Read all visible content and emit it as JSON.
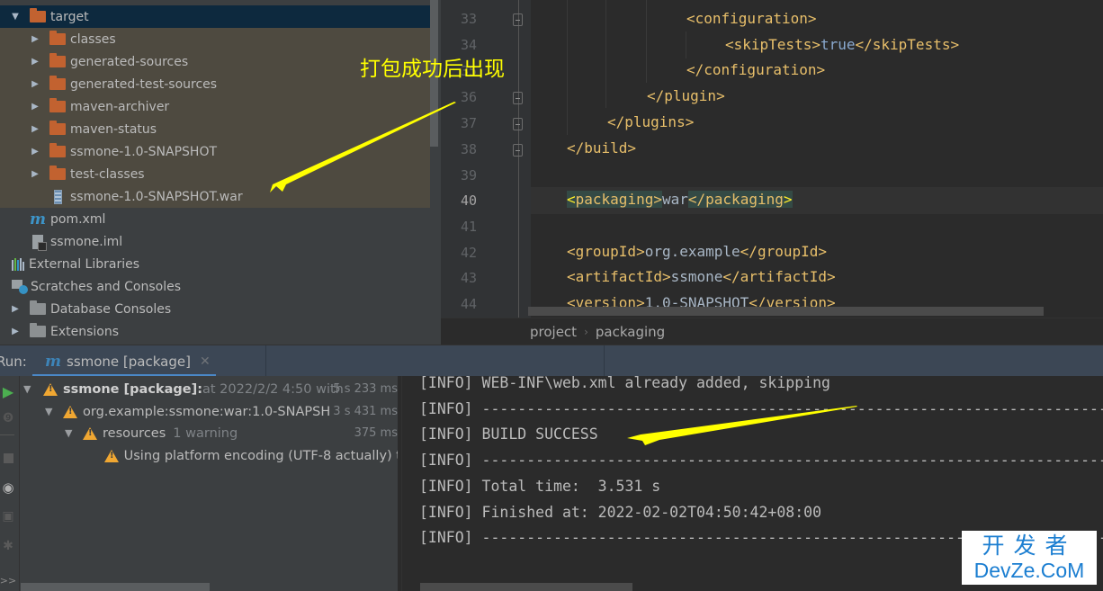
{
  "project_tree": {
    "items": [
      {
        "label": "target",
        "type": "folder",
        "expanded": true,
        "depth": 0
      },
      {
        "label": "classes",
        "type": "folder",
        "expanded": false,
        "depth": 1
      },
      {
        "label": "generated-sources",
        "type": "folder",
        "expanded": false,
        "depth": 1
      },
      {
        "label": "generated-test-sources",
        "type": "folder",
        "expanded": false,
        "depth": 1
      },
      {
        "label": "maven-archiver",
        "type": "folder",
        "expanded": false,
        "depth": 1
      },
      {
        "label": "maven-status",
        "type": "folder",
        "expanded": false,
        "depth": 1
      },
      {
        "label": "ssmone-1.0-SNAPSHOT",
        "type": "folder",
        "expanded": false,
        "depth": 1
      },
      {
        "label": "test-classes",
        "type": "folder",
        "expanded": false,
        "depth": 1
      },
      {
        "label": "ssmone-1.0-SNAPSHOT.war",
        "type": "war-file",
        "depth": 1
      },
      {
        "label": "pom.xml",
        "type": "maven-file",
        "depth": 0
      },
      {
        "label": "ssmone.iml",
        "type": "iml-file",
        "depth": 0
      },
      {
        "label": "External Libraries",
        "type": "libraries",
        "depth": -1
      },
      {
        "label": "Scratches and Consoles",
        "type": "scratches",
        "depth": -1
      },
      {
        "label": "Database Consoles",
        "type": "grey-folder",
        "depth": 0
      },
      {
        "label": "Extensions",
        "type": "grey-folder",
        "depth": 0
      }
    ]
  },
  "annotation": {
    "text": "打包成功后出现",
    "color": "#ffff00"
  },
  "editor": {
    "lines": [
      {
        "num": "33",
        "code": "<configuration>"
      },
      {
        "num": "34",
        "code": "<skipTests>true</skipTests>"
      },
      {
        "num": "35",
        "code": "</configuration>"
      },
      {
        "num": "36",
        "code": "</plugin>"
      },
      {
        "num": "37",
        "code": "</plugins>"
      },
      {
        "num": "38",
        "code": "</build>"
      },
      {
        "num": "39",
        "code": ""
      },
      {
        "num": "40",
        "code": "<packaging>war</packaging>"
      },
      {
        "num": "41",
        "code": ""
      },
      {
        "num": "42",
        "code": "<groupId>org.example</groupId>"
      },
      {
        "num": "43",
        "code": "<artifactId>ssmone</artifactId>"
      },
      {
        "num": "44",
        "code": "<version>1.0-SNAPSHOT</version>"
      }
    ],
    "tokens": {
      "l33": "<configuration>",
      "l34_open": "<skipTests>",
      "l34_val": "true",
      "l34_close": "</skipTests>",
      "l35": "</configuration>",
      "l36": "</plugin>",
      "l37": "</plugins>",
      "l38": "</build>",
      "l40_open_lt": "<",
      "l40_open": "packaging",
      "l40_open_gt": ">",
      "l40_val": "war",
      "l40_close_lt": "</",
      "l40_close": "packaging",
      "l40_close_gt": ">",
      "l42_open": "<groupId>",
      "l42_val": "org.example",
      "l42_close": "</groupId>",
      "l43_open": "<artifactId>",
      "l43_val": "ssmone",
      "l43_close": "</artifactId>",
      "l44_open": "<version>",
      "l44_val": "1.0-SNAPSHOT",
      "l44_close": "</version>"
    },
    "current_line": "40",
    "breadcrumbs": [
      "project",
      "packaging"
    ]
  },
  "run_panel": {
    "label": "Run:",
    "tab": {
      "icon": "maven-icon",
      "label": "ssmone [package]"
    },
    "build_tree": [
      {
        "title": "ssmone [package]:",
        "detail": " at 2022/2/2 4:50 with",
        "time": "5 s 233 ms",
        "depth": 0,
        "expanded": true
      },
      {
        "title": "org.example:ssmone:war:1.0-SNAPSH",
        "detail": "",
        "time": "3 s 431 ms",
        "depth": 1,
        "expanded": true
      },
      {
        "title": "resources",
        "detail": "1 warning",
        "time": "375 ms",
        "depth": 2,
        "expanded": true
      },
      {
        "title": "Using platform encoding (UTF-8 actually) t",
        "detail": "",
        "time": "",
        "depth": 3
      }
    ],
    "toolbar": [
      "rerun-icon",
      "debug-icon",
      "stop-icon",
      "view-icon",
      "camera-icon",
      "settings-bug-icon",
      "more-icon"
    ],
    "more_label": ">>"
  },
  "console": {
    "lines": [
      "[INFO] WEB-INF\\web.xml already added, skipping",
      "[INFO] ------------------------------------------------------------------------",
      "[INFO] BUILD SUCCESS",
      "[INFO] ------------------------------------------------------------------------",
      "[INFO] Total time:  3.531 s",
      "[INFO] Finished at: 2022-02-02T04:50:42+08:00",
      "[INFO] ------------------------------------------------------------------------"
    ]
  },
  "watermark": {
    "cn": "开发者",
    "en": "DevZe.CoM",
    "color": "#1b7ed1"
  }
}
